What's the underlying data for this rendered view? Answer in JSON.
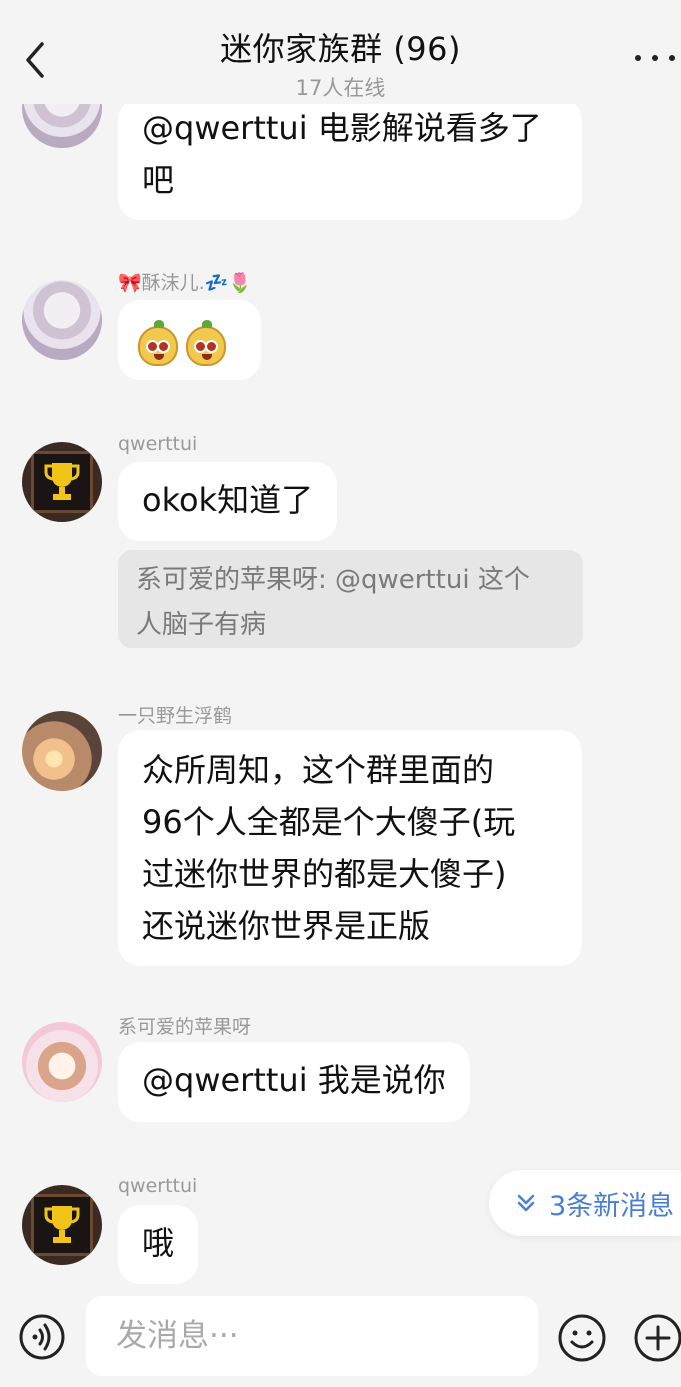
{
  "header": {
    "title": "迷你家族群 (96)",
    "subtitle": "17人在线"
  },
  "messages": [
    {
      "sender": "",
      "text": "@qwerttui 电影解说看多了\n吧"
    },
    {
      "sender": "🎀酥沫儿.💤🌷",
      "emoji_count": 2
    },
    {
      "sender": "qwerttui",
      "text": "okok知道了",
      "quote": "系可爱的苹果呀: @qwerttui 这个\n人脑子有病"
    },
    {
      "sender": "一只野生浮鹤",
      "text": "众所周知，这个群里面的\n96个人全都是个大傻子(玩\n过迷你世界的都是大傻子)\n还说迷你世界是正版"
    },
    {
      "sender": "系可爱的苹果呀",
      "text": "@qwerttui 我是说你"
    },
    {
      "sender": "qwerttui",
      "text": "哦"
    }
  ],
  "new_messages": {
    "label": "3条新消息"
  },
  "input": {
    "placeholder": "发消息···"
  },
  "colors": {
    "background": "#f4f4f4",
    "bubble": "#ffffff",
    "quote_bg": "#e6e6e6",
    "accent": "#4a7fd0"
  },
  "icons": [
    "back-chevron-icon",
    "more-dots-icon",
    "voice-icon",
    "emoji-icon",
    "plus-icon",
    "double-chevron-down-icon",
    "trophy-icon"
  ]
}
